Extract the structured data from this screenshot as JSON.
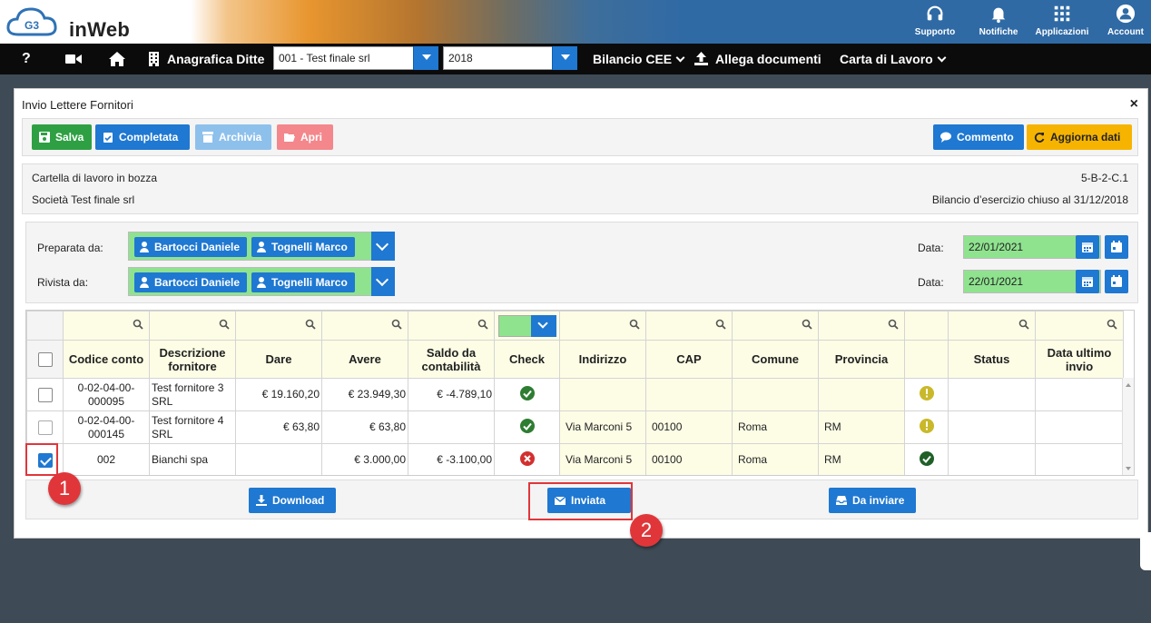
{
  "brand": {
    "logo_text": "inWeb",
    "logo_badge": "G3"
  },
  "top_icons": [
    {
      "label": "Supporto",
      "icon": "headset-icon"
    },
    {
      "label": "Notifiche",
      "icon": "bell-icon"
    },
    {
      "label": "Applicazioni",
      "icon": "apps-grid-icon"
    },
    {
      "label": "Account",
      "icon": "account-icon"
    }
  ],
  "nav": {
    "help": "?",
    "anagrafica": "Anagrafica Ditte",
    "company_select": "001 - Test finale srl",
    "year_select": "2018",
    "bilancio": "Bilancio CEE",
    "allega": "Allega documenti",
    "carta": "Carta di Lavoro"
  },
  "modal": {
    "title": "Invio Lettere Fornitori",
    "close": "×",
    "toolbar": {
      "salva": "Salva",
      "completata": "Completata",
      "archivia": "Archivia",
      "apri": "Apri",
      "commento": "Commento",
      "aggiorna": "Aggiorna dati"
    },
    "info": {
      "stato": "Cartella di lavoro in bozza",
      "codice": "5-B-2-C.1",
      "societa": "Società Test finale srl",
      "bilancio": "Bilancio d’esercizio chiuso al 31/12/2018"
    },
    "preparata": {
      "label": "Preparata da:",
      "people": [
        "Bartocci Daniele",
        "Tognelli Marco"
      ],
      "date_label": "Data:",
      "date": "22/01/2021"
    },
    "rivista": {
      "label": "Rivista da:",
      "people": [
        "Bartocci Daniele",
        "Tognelli Marco"
      ],
      "date_label": "Data:",
      "date": "22/01/2021"
    },
    "table": {
      "headers": {
        "codice": "Codice conto",
        "descrizione": "Descrizione fornitore",
        "dare": "Dare",
        "avere": "Avere",
        "saldo": "Saldo da contabilità",
        "check": "Check",
        "indirizzo": "Indirizzo",
        "cap": "CAP",
        "comune": "Comune",
        "provincia": "Provincia",
        "status": "Status",
        "data_invio": "Data ultimo invio"
      },
      "rows": [
        {
          "codice": "0-02-04-00-000095",
          "descrizione": "Test fornitore 3 SRL",
          "dare": "€ 19.160,20",
          "avere": "€ 23.949,30",
          "saldo": "€ -4.789,10",
          "check": "ok",
          "indirizzo": "",
          "cap": "",
          "comune": "",
          "provincia": "",
          "flag": "warning"
        },
        {
          "codice": "0-02-04-00-000145",
          "descrizione": "Test fornitore 4 SRL",
          "dare": "€ 63,80",
          "avere": "€ 63,80",
          "saldo": "",
          "check": "ok",
          "indirizzo": "Via Marconi 5",
          "cap": "00100",
          "comune": "Roma",
          "provincia": "RM",
          "flag": "warning"
        },
        {
          "codice": "002",
          "descrizione": "Bianchi spa",
          "dare": "",
          "avere": "€ 3.000,00",
          "saldo": "€ -3.100,00",
          "check": "error",
          "indirizzo": "Via Marconi 5",
          "cap": "00100",
          "comune": "Roma",
          "provincia": "RM",
          "flag": "ok"
        }
      ]
    },
    "actions": {
      "download": "Download",
      "inviata": "Inviata",
      "da_inviare": "Da inviare"
    }
  },
  "annotations": [
    "1",
    "2"
  ],
  "colors": {
    "primary": "#1f78d1",
    "success": "#2ea043",
    "warning": "#f2b705",
    "danger": "#e0363a",
    "green_field": "#8fe38f"
  }
}
